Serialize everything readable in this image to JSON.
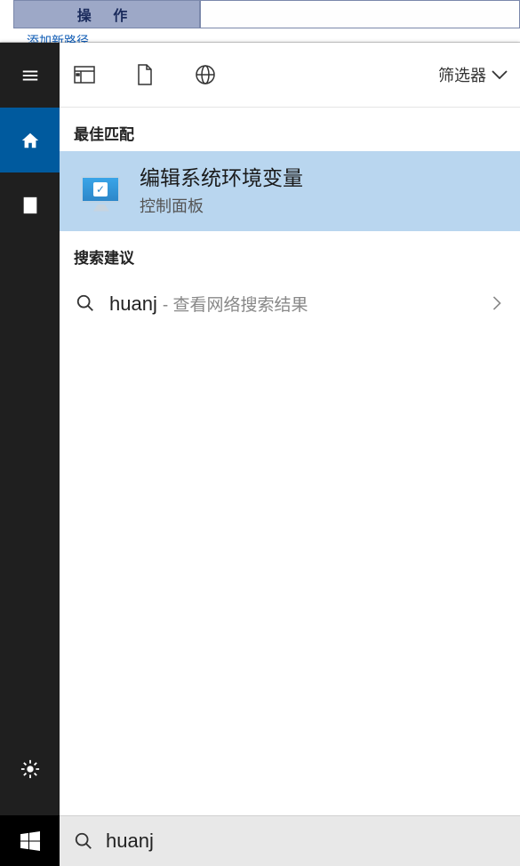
{
  "background": {
    "header_cell": "操  作",
    "link_text": "添加新路径"
  },
  "filter_label": "筛选器",
  "sections": {
    "best_match": "最佳匹配",
    "suggestions": "搜索建议"
  },
  "best_match": {
    "title": "编辑系统环境变量",
    "subtitle": "控制面板"
  },
  "suggestion": {
    "query": "huanj",
    "hint": "- 查看网络搜索结果"
  },
  "search": {
    "value": "huanj"
  }
}
